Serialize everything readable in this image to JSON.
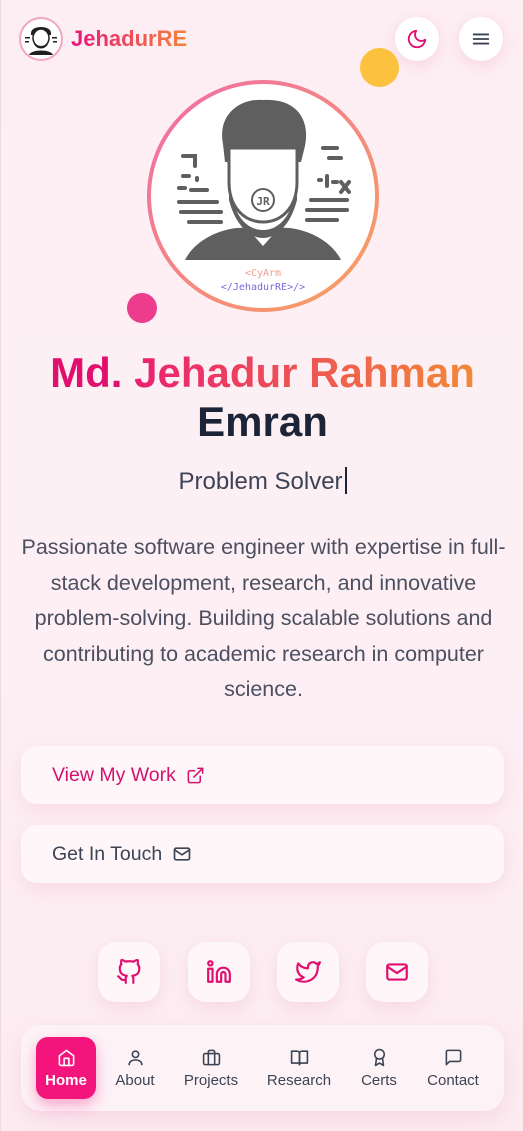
{
  "header": {
    "brand": "JehadurRE",
    "theme_icon": "moon-icon",
    "menu_icon": "menu-icon"
  },
  "hero": {
    "avatar_tag_line1": "<CyArm",
    "avatar_tag_line2": "</JehadurRE>/>",
    "avatar_monogram": "JR",
    "name_first": "Md.",
    "name_middle": "Jehadur Rahman",
    "name_last": "Emran",
    "role": "Problem Solver",
    "bio": "Passionate software engineer with expertise in full-stack development, research, and innovative problem-solving. Building scalable solutions and contributing to academic research in computer science."
  },
  "actions": {
    "view_work": "View My Work",
    "get_in_touch": "Get In Touch"
  },
  "socials": [
    "github-icon",
    "linkedin-icon",
    "twitter-icon",
    "mail-icon"
  ],
  "nav": {
    "items": [
      {
        "label": "Home",
        "icon": "home-icon",
        "active": true
      },
      {
        "label": "About",
        "icon": "user-icon"
      },
      {
        "label": "Projects",
        "icon": "briefcase-icon"
      },
      {
        "label": "Research",
        "icon": "book-icon"
      },
      {
        "label": "Certs",
        "icon": "award-icon"
      },
      {
        "label": "Contact",
        "icon": "message-icon"
      }
    ]
  },
  "colors": {
    "accent": "#e10f6e",
    "accent_orange": "#f28a36",
    "dark_text": "#1e2438",
    "active_nav": "#f3147c"
  }
}
